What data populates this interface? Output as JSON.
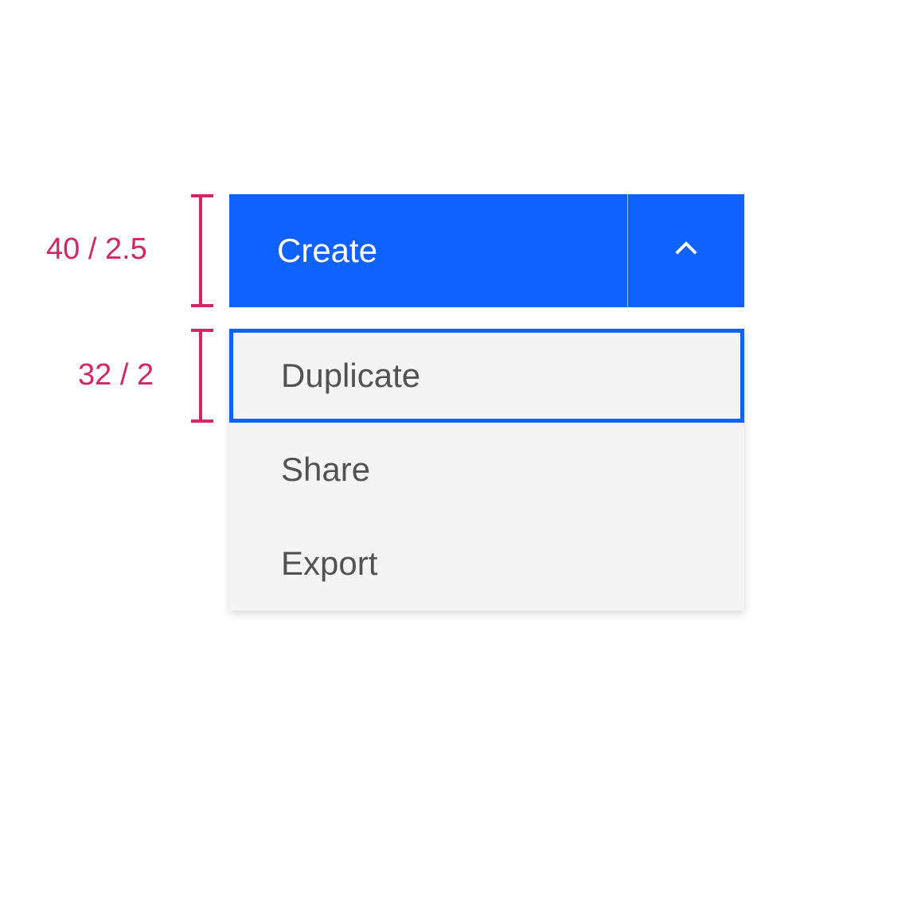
{
  "annotations": {
    "button_height": "40 / 2.5",
    "menu_item_height": "32 / 2"
  },
  "button": {
    "primary_label": "Create"
  },
  "menu": {
    "items": [
      {
        "label": "Duplicate",
        "focused": true
      },
      {
        "label": "Share",
        "focused": false
      },
      {
        "label": "Export",
        "focused": false
      }
    ]
  },
  "colors": {
    "primary": "#0f62fe",
    "annotation": "#d12765",
    "menu_bg": "#f4f4f4",
    "text_secondary": "#525252"
  }
}
